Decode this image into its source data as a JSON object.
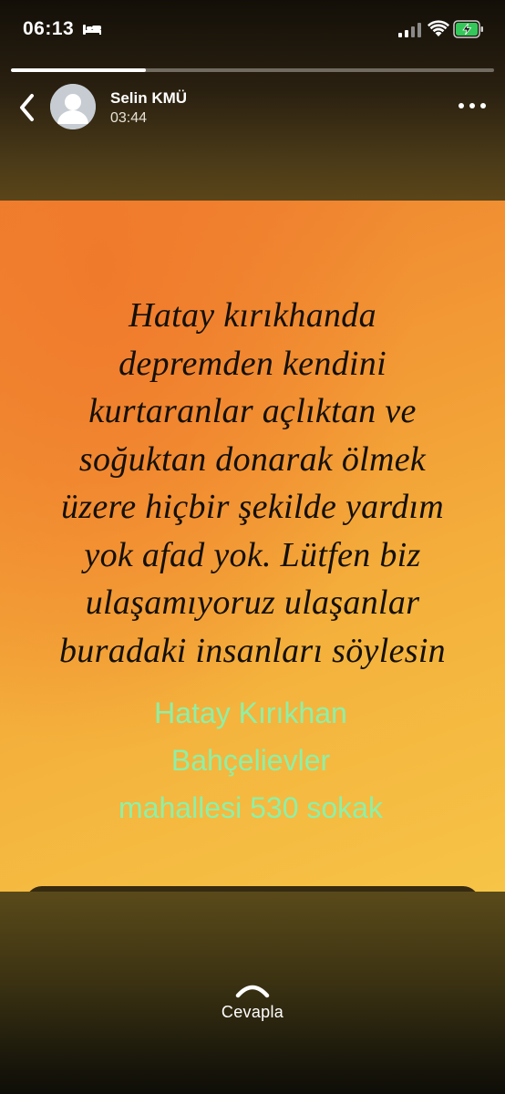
{
  "status_bar": {
    "time": "06:13",
    "bed_icon": "bed-icon",
    "signal_icon": "cellular-signal-icon",
    "wifi_icon": "wifi-icon",
    "battery_icon": "battery-charging-icon",
    "battery_color": "#34c759"
  },
  "story": {
    "progress_fraction": 0.28,
    "user_name": "Selin KMÜ",
    "time": "03:44",
    "image_text_lines": [
      "Hatay kırıkhanda",
      "depremden kendini",
      "kurtaranlar açlıktan ve",
      "soğuktan donarak ölmek",
      "üzere hiçbir şekilde yardım",
      "yok afad yok. Lütfen biz",
      "ulaşamıyoruz ulaşanlar",
      "buradaki insanları söylesin"
    ],
    "address_lines": [
      "Hatay Kırıkhan",
      "Bahçelievler",
      "mahallesi 530 sokak"
    ],
    "address_color": "#8ef0a6"
  },
  "reply": {
    "label": "Cevapla",
    "icon": "chevron-up-icon"
  }
}
